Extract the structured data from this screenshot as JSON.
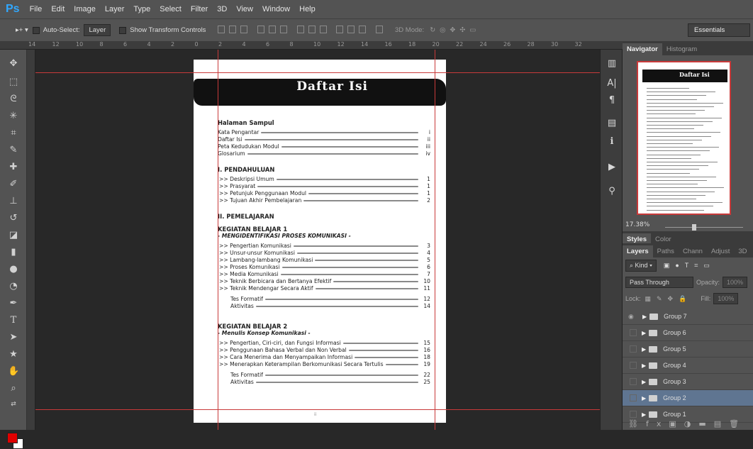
{
  "menubar": {
    "logo": "Ps",
    "items": [
      "File",
      "Edit",
      "Image",
      "Layer",
      "Type",
      "Select",
      "Filter",
      "3D",
      "View",
      "Window",
      "Help"
    ]
  },
  "options": {
    "auto_select": "Auto-Select:",
    "auto_select_value": "Layer",
    "show_transform": "Show Transform Controls",
    "mode3d": "3D Mode:",
    "workspace": "Essentials"
  },
  "ruler": {
    "ticks": [
      "14",
      "12",
      "10",
      "8",
      "6",
      "4",
      "2",
      "0",
      "2",
      "4",
      "6",
      "8",
      "10",
      "12",
      "14",
      "16",
      "18",
      "20",
      "22",
      "24",
      "26",
      "28",
      "30",
      "32"
    ]
  },
  "document": {
    "title": "Daftar Isi",
    "page_number": "ii",
    "sections": [
      {
        "heading": "Halaman Sampul",
        "rows": [
          {
            "label": "Kata Pengantar",
            "page": "i"
          },
          {
            "label": "Daftar Isi",
            "page": "ii"
          },
          {
            "label": "Peta Kedudukan Modul",
            "page": "iii"
          },
          {
            "label": "Glosarium",
            "page": "iv"
          }
        ]
      },
      {
        "heading": "I.  PENDAHULUAN",
        "rows": [
          {
            "label": ">> Deskripsi Umum",
            "page": "1"
          },
          {
            "label": ">> Prasyarat",
            "page": "1"
          },
          {
            "label": ">> Petunjuk Penggunaan Modul",
            "page": "1"
          },
          {
            "label": ">> Tujuan Akhir Pembelajaran",
            "page": "2"
          }
        ]
      },
      {
        "heading": "II. PEMELAJARAN",
        "sub": "KEGIATAN BELAJAR 1",
        "sub2": "- MENGIDENTIFIKASI PROSES KOMUNIKASI -",
        "rows": [
          {
            "label": ">> Pengertian Komunikasi",
            "page": "3"
          },
          {
            "label": ">> Unsur-unsur Komunikasi",
            "page": "4"
          },
          {
            "label": ">> Lambang-lambang Komunikasi",
            "page": "5"
          },
          {
            "label": ">> Proses Komunikasi",
            "page": "6"
          },
          {
            "label": ">> Media Komunikasi",
            "page": "7"
          },
          {
            "label": ">> Teknik Berbicara dan Bertanya Efektif",
            "page": "10"
          },
          {
            "label": ">> Teknik Mendengar Secara Aktif",
            "page": "11"
          }
        ],
        "extra": [
          {
            "label": "Tes Formatif",
            "page": "12"
          },
          {
            "label": "Aktivitas",
            "page": "14"
          }
        ]
      },
      {
        "sub": "KEGIATAN BELAJAR 2",
        "sub2": "- Menulis Konsep Komunikasi -",
        "rows": [
          {
            "label": ">> Pengertian, Ciri-ciri, dan Fungsi Informasi",
            "page": "15"
          },
          {
            "label": ">> Penggunaan Bahasa Verbal dan Non Verbal",
            "page": "16"
          },
          {
            "label": ">> Cara Menerima dan Menyampaikan Informasi",
            "page": "18"
          },
          {
            "label": ">> Menerapkan Keterampilan Berkomunikasi Secara Tertulis",
            "page": "19"
          }
        ],
        "extra": [
          {
            "label": "Tes Formatif",
            "page": "22"
          },
          {
            "label": "Aktivitas",
            "page": "25"
          }
        ]
      }
    ]
  },
  "panel": {
    "nav_tabs": [
      "Navigator",
      "Histogram"
    ],
    "zoom": "17.38%",
    "style_tabs": [
      "Styles",
      "Color"
    ],
    "layer_tabs": [
      "Layers",
      "Paths",
      "Chann",
      "Adjust",
      "3D"
    ],
    "kind": "Kind",
    "blend": "Pass Through",
    "opacity_label": "Opacity:",
    "opacity": "100%",
    "lock_label": "Lock:",
    "fill_label": "Fill:",
    "fill": "100%",
    "layers": [
      "Group 7",
      "Group 6",
      "Group 5",
      "Group 4",
      "Group 3",
      "Group 2",
      "Group 1"
    ],
    "selected_layer": "Group 2"
  }
}
